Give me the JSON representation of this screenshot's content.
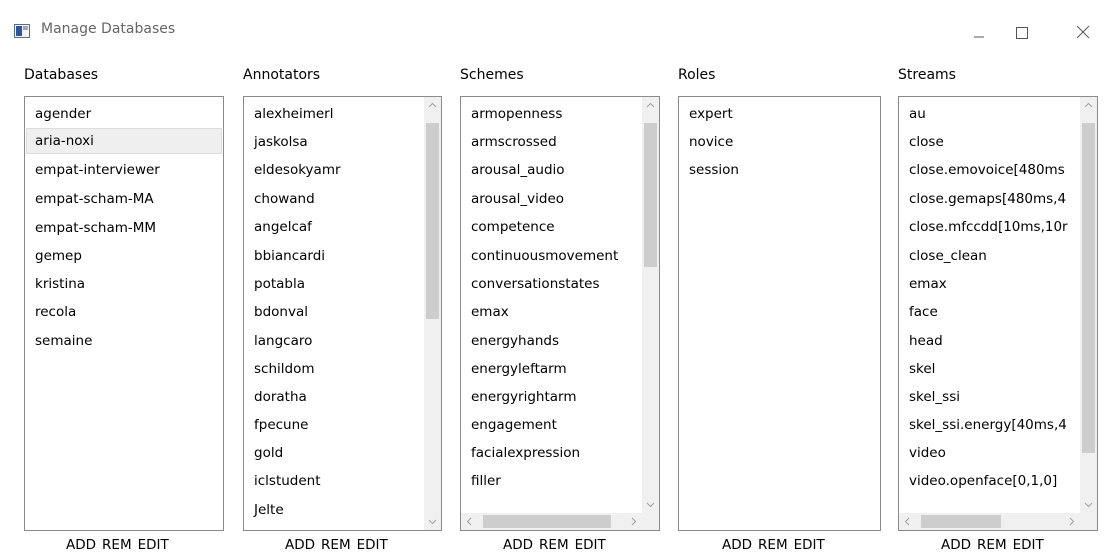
{
  "window": {
    "title": "Manage Databases"
  },
  "panels": [
    {
      "title": "Databases",
      "items": [
        "agender",
        "aria-noxi",
        "empat-interviewer",
        "empat-scham-MA",
        "empat-scham-MM",
        "gemep",
        "kristina",
        "recola",
        "semaine"
      ],
      "selected": "aria-noxi",
      "buttons": [
        "ADD",
        "REM",
        "EDIT"
      ]
    },
    {
      "title": "Annotators",
      "items": [
        "alexheimerl",
        "jaskolsa",
        "eldesokyamr",
        "chowand",
        "angelcaf",
        "bbiancardi",
        "potabla",
        "bdonval",
        "langcaro",
        "schildom",
        "doratha",
        "fpecune",
        "gold",
        "iclstudent",
        "Jelte"
      ],
      "buttons": [
        "ADD",
        "REM",
        "EDIT"
      ]
    },
    {
      "title": "Schemes",
      "items": [
        "armopenness",
        "armscrossed",
        "arousal_audio",
        "arousal_video",
        "competence",
        "continuousmovement",
        "conversationstates",
        "emax",
        "energyhands",
        "energyleftarm",
        "energyrightarm",
        "engagement",
        "facialexpression",
        "filler"
      ],
      "buttons": [
        "ADD",
        "REM",
        "EDIT"
      ]
    },
    {
      "title": "Roles",
      "items": [
        "expert",
        "novice",
        "session"
      ],
      "buttons": [
        "ADD",
        "REM",
        "EDIT"
      ]
    },
    {
      "title": "Streams",
      "items": [
        "au",
        "close",
        "close.emovoice[480ms",
        "close.gemaps[480ms,4",
        "close.mfccdd[10ms,10r",
        "close_clean",
        "emax",
        "face",
        "head",
        "skel",
        "skel_ssi",
        "skel_ssi.energy[40ms,4",
        "video",
        "video.openface[0,1,0]"
      ],
      "buttons": [
        "ADD",
        "REM",
        "EDIT"
      ]
    }
  ],
  "icons": {
    "app": "window-app-icon",
    "minimize": "minimize-icon",
    "maximize": "maximize-icon",
    "close": "close-icon"
  }
}
